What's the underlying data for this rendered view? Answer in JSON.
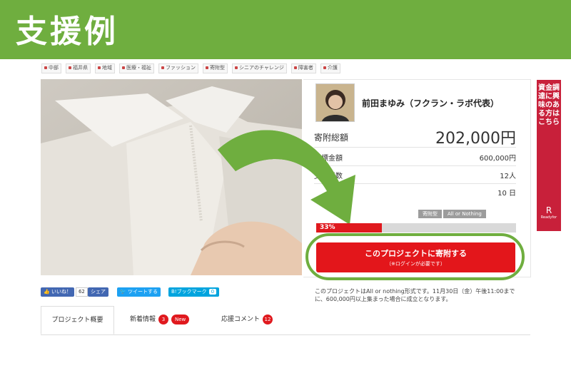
{
  "banner": {
    "title": "支援例",
    "color": "#6fae3f"
  },
  "tags": [
    "中部",
    "福井県",
    "地域",
    "医療・福祉",
    "ファッション",
    "寄附型",
    "シニアのチャレンジ",
    "障害者",
    "介護"
  ],
  "project": {
    "owner": "前田まゆみ（フクラン・ラボ代表）",
    "raised_label": "寄附総額",
    "raised_value": "202,000円",
    "goal_label": "目標金額",
    "goal_value": "600,000円",
    "supporters_label": "支援者数",
    "supporters_value": "12人",
    "remaining_label": "",
    "remaining_value": "10 日",
    "badge_type": "寄附型",
    "badge_mode": "All or Nothing",
    "progress_text": "33%",
    "progress_fraction": 0.33,
    "cta_main": "このプロジェクトに寄附する",
    "cta_sub": "（※ログインが必要です）",
    "notice": "このプロジェクトはAll or nothing形式です。11月30日（金）午後11:00までに、600,000円以上集まった場合に成立となります。"
  },
  "social": {
    "like_label": "いいね！",
    "like_count": "62",
    "share_label": "シェア",
    "tweet_label": "ツイートする",
    "hatena_label": "B!ブックマーク",
    "hatena_count": "0"
  },
  "tabs": {
    "overview": "プロジェクト概要",
    "news": "新着情報",
    "news_count": "3",
    "news_badge": "New",
    "comments": "応援コメント",
    "comments_count": "12"
  },
  "sidebar": {
    "text": "資金調達に興味のある方はこちら",
    "logo_symbol": "R",
    "logo_name": "Readyfor"
  },
  "colors": {
    "accent_green": "#6fae3f",
    "cta_red": "#e3161b",
    "sidebar_red": "#c8203a"
  },
  "icons": [
    "tag-icon",
    "thumbs-up-icon",
    "twitter-bird-icon",
    "readyfor-logo-icon",
    "curved-arrow-icon"
  ]
}
